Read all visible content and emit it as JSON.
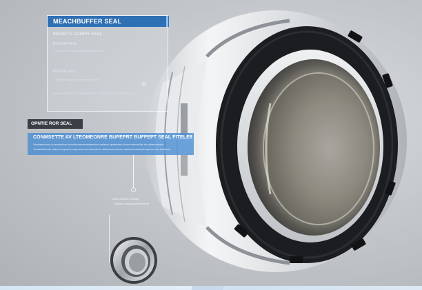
{
  "panel_top": {
    "title": "MEACHBUFFER SEAL",
    "subtitle": "MONOTE COMMY SEAL",
    "item1_label": "BUIDORFFEAL",
    "item1_desc": "Trecyehet ox cylineuring exoducpesentor",
    "item2_label": "BOIUPE FFEL",
    "item2_desc": "1. BEM thyoaymonin ret cersioerduer.",
    "item3_desc": "OUSAHEOOCRICE LERBLDRIIEAL TRIBUTORIHIGEERINCED"
  },
  "tag_dark": {
    "label": "OPNTIE ROR SEAL"
  },
  "banner": {
    "title": "CONMSETTE AV LTEOMEONRE BUPEPRT BUFFEPT SEAL FITELE8",
    "line1": "Nonstaenecem ty teedoeioce ernedtecueccetntedseciea oneleren apetectrne ehoor retrenerthe de cabaurerbebe",
    "line2": "Tereddeticnorte retinoer sepoeuh soyeonue iaounesedur to deteeroneroorneo odeertonecearentorpceoe ode stodaeon"
  },
  "callout": {
    "line1": "Ooao omnuorx bucoie",
    "line2": "Bcoiour ncmooaraoeneal fre"
  },
  "colors": {
    "accent_blue": "#2f6fb4",
    "banner_blue": "#468cd2",
    "dark_tag": "#3a3f45",
    "seal_black": "#1b1d20",
    "seal_silver": "#e6e8ea"
  }
}
